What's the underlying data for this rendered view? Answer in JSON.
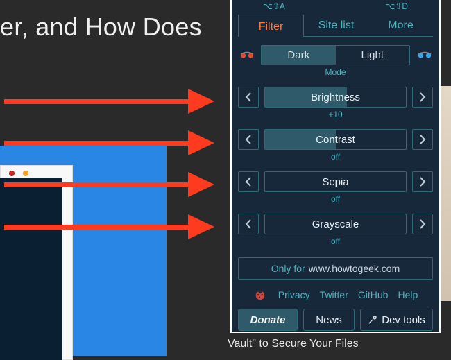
{
  "background": {
    "title_fragment": "er, and How Does",
    "vault_fragment": "Vault\" to Secure Your Files"
  },
  "shortcuts": {
    "left": "⌥⇧A",
    "right": "⌥⇧D"
  },
  "tabs": [
    "Filter",
    "Site list",
    "More"
  ],
  "mode": {
    "dark": "Dark",
    "light": "Light",
    "label": "Mode"
  },
  "sliders": [
    {
      "name": "Brightness",
      "value": "+10",
      "fill_pct": 58
    },
    {
      "name": "Contrast",
      "value": "off",
      "fill_pct": 50
    },
    {
      "name": "Sepia",
      "value": "off",
      "fill_pct": 0
    },
    {
      "name": "Grayscale",
      "value": "off",
      "fill_pct": 0
    }
  ],
  "onlyfor": {
    "prefix": "Only for",
    "domain": "www.howtogeek.com"
  },
  "links": {
    "privacy": "Privacy",
    "twitter": "Twitter",
    "github": "GitHub",
    "help": "Help"
  },
  "actions": {
    "donate": "Donate",
    "news": "News",
    "devtools": "Dev tools"
  },
  "colors": {
    "panel_bg": "#18283b",
    "accent": "#4db3bf",
    "active_tab": "#ff7b3e",
    "fill": "#2f5a6a",
    "border": "#2e6a78",
    "arrow": "#ff3b1f"
  }
}
